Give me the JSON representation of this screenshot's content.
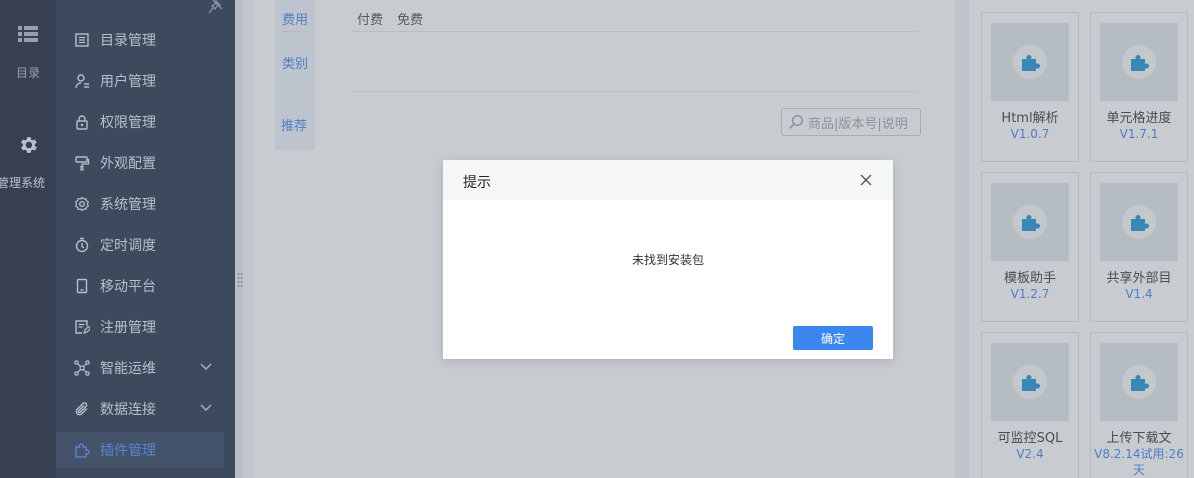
{
  "rail": {
    "catalog_label": "目录",
    "system_label": "管理系统"
  },
  "sidebar": {
    "items": [
      {
        "label": "目录管理"
      },
      {
        "label": "用户管理"
      },
      {
        "label": "权限管理"
      },
      {
        "label": "外观配置"
      },
      {
        "label": "系统管理"
      },
      {
        "label": "定时调度"
      },
      {
        "label": "移动平台"
      },
      {
        "label": "注册管理"
      },
      {
        "label": "智能运维"
      },
      {
        "label": "数据连接"
      },
      {
        "label": "插件管理"
      }
    ],
    "active_item": "插件管理"
  },
  "filters": {
    "fee_tab": "费用",
    "category_tab": "类别",
    "recommend_tab": "推荐",
    "fee_options": [
      "付费",
      "免费"
    ]
  },
  "search": {
    "placeholder": "商品|版本号|说明"
  },
  "plugins": [
    {
      "name": "Html解析",
      "version": "V1.0.7"
    },
    {
      "name": "单元格进度",
      "version": "V1.7.1"
    },
    {
      "name": "模板助手",
      "version": "V1.2.7"
    },
    {
      "name": "共享外部目",
      "version": "V1.4"
    },
    {
      "name": "可监控SQL",
      "version": "V2.4"
    },
    {
      "name": "上传下载文",
      "version": "V8.2.14试用:26天"
    }
  ],
  "dialog": {
    "title": "提示",
    "message": "未找到安装包",
    "ok_label": "确定"
  },
  "colors": {
    "accent": "#3c86f0",
    "sidebar_bg": "#1f2d44",
    "rail_bg": "#141e30"
  }
}
